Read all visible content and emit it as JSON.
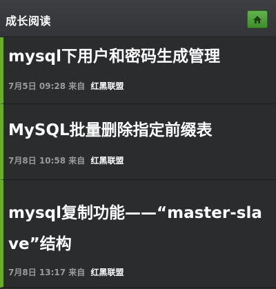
{
  "header": {
    "title": "成长阅读",
    "home_icon": "home-icon",
    "accent": "#4fa33a"
  },
  "list": {
    "accent_bar": "#6aac2f",
    "items": [
      {
        "title": "mysql下用户和密码生成管理",
        "date": "7月5日 09:28",
        "from_label": "来自",
        "source": "红黑联盟"
      },
      {
        "title": "MySQL批量删除指定前缀表",
        "date": "7月8日 10:58",
        "from_label": "来自",
        "source": "红黑联盟"
      },
      {
        "title": "mysql复制功能——“master-slave”结构",
        "date": "7月8日 13:17",
        "from_label": "来自",
        "source": "红黑联盟"
      }
    ]
  }
}
